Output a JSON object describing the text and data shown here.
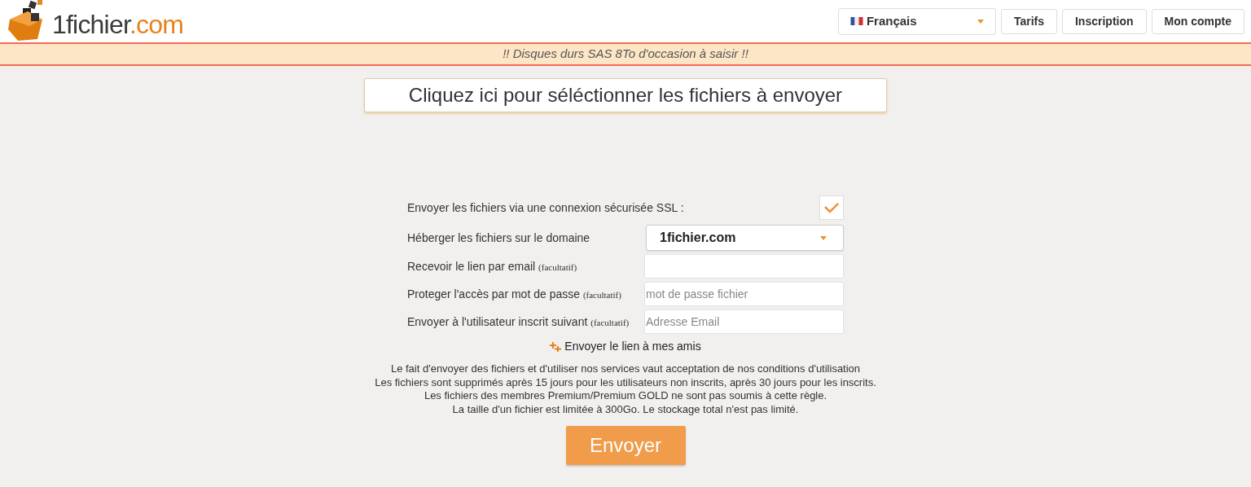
{
  "logo": {
    "name": "1fichier",
    "suffix": ".com"
  },
  "nav": {
    "language": {
      "label": "Français"
    },
    "buttons": [
      "Tarifs",
      "Inscription",
      "Mon compte"
    ]
  },
  "banner": "!! Disques durs SAS 8To d'occasion à saisir !!",
  "select_files": "Cliquez ici pour séléctionner les fichiers à envoyer",
  "form": [
    {
      "kind": "checkbox",
      "label": "Envoyer les fichiers via une connexion sécurisée SSL :",
      "checked": true
    },
    {
      "kind": "select",
      "label": "Héberger les fichiers sur le domaine",
      "value": "1fichier.com"
    },
    {
      "kind": "input",
      "label": "Recevoir le lien par email",
      "note": "(facultatif)"
    },
    {
      "kind": "input",
      "label": "Proteger l'accès par mot de passe",
      "note": "(facultatif)",
      "placeholder": "mot de passe fichier"
    },
    {
      "kind": "input",
      "label": "Envoyer à l'utilisateur inscrit suivant",
      "note": "(facultatif)",
      "placeholder": "Adresse Email"
    }
  ],
  "friends_link": "Envoyer le lien à mes amis",
  "notices": [
    "Le fait d'envoyer des fichiers et d'utiliser nos services vaut acceptation de nos conditions d'utilisation",
    "Les fichiers sont supprimés après 15 jours pour les utilisateurs non inscrits, après 30 jours pour les inscrits.",
    "Les fichiers des membres Premium/Premium GOLD ne sont pas soumis à cette règle.",
    "La taille d'un fichier est limitée à 300Go. Le stockage total n'est pas limité."
  ],
  "submit": "Envoyer"
}
